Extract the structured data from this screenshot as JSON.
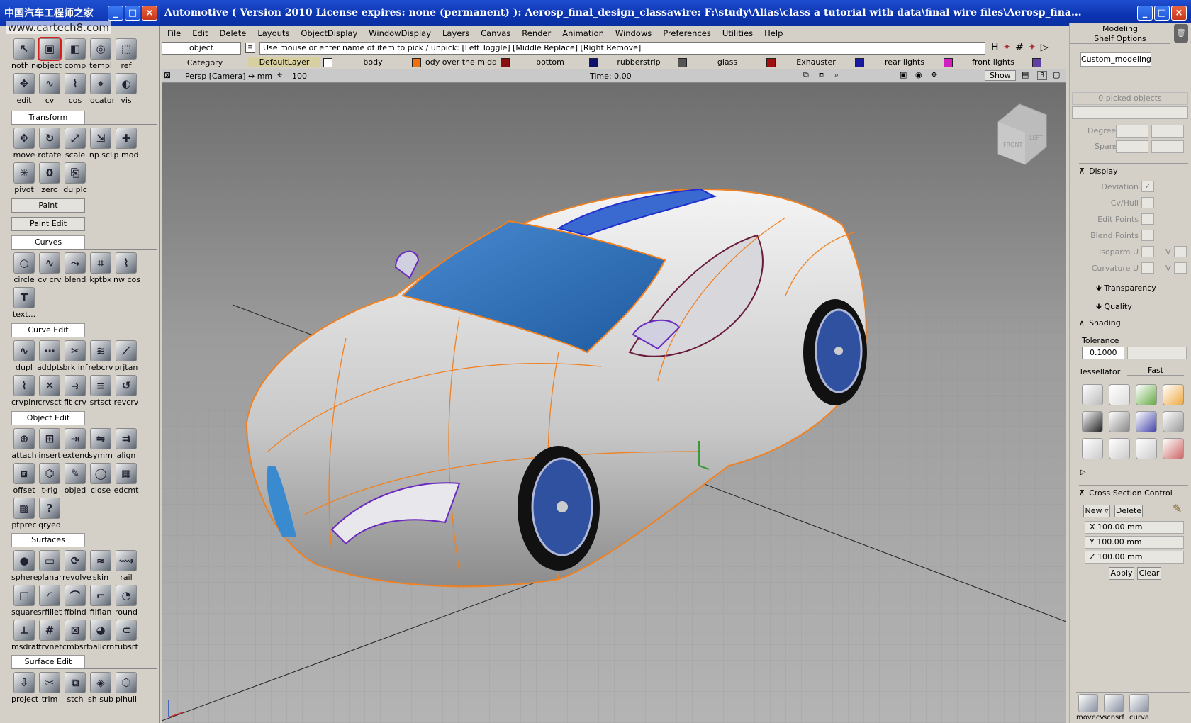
{
  "window": {
    "title": "Automotive ( Version 2010  License expires: none (permanent) ): Aerosp_final_design_classawire: F:\\study\\Alias\\class a tutorial with data\\final wire files\\Aerosp_fina...",
    "palette_title": "中国汽车工程师之家",
    "watermark": "www.cartech8.com"
  },
  "menu": [
    "File",
    "Edit",
    "Delete",
    "Layouts",
    "ObjectDisplay",
    "WindowDisplay",
    "Layers",
    "Canvas",
    "Render",
    "Animation",
    "Windows",
    "Preferences",
    "Utilities",
    "Help"
  ],
  "pick": {
    "mode": "object",
    "message": "Use mouse or enter name of item to pick / unpick: [Left Toggle] [Middle Replace] [Right Remove]"
  },
  "layers": {
    "category_label": "Category",
    "items": [
      {
        "name": "DefaultLayer",
        "color": "#ffffff"
      },
      {
        "name": "body",
        "color": "#f07010"
      },
      {
        "name": "ody over the middle",
        "color": "#8a1010"
      },
      {
        "name": "bottom",
        "color": "#101070"
      },
      {
        "name": "rubberstrip",
        "color": "#555555"
      },
      {
        "name": "glass",
        "color": "#a01010"
      },
      {
        "name": "Exhauster",
        "color": "#1a1aa0"
      },
      {
        "name": "rear lights",
        "color": "#d020c0"
      },
      {
        "name": "front lights",
        "color": "#6040a0"
      }
    ]
  },
  "viewport": {
    "camera": "Persp [Camera] ↔ mm",
    "grid": "100",
    "time": "Time: 0.00",
    "show_button": "Show",
    "layout_num": "3",
    "cube_front": "FRONT",
    "cube_left": "LEFT"
  },
  "palette": {
    "pick_tools": [
      "nothing",
      "object",
      "comp",
      "templ",
      "ref",
      "edit",
      "cv",
      "cos",
      "locator",
      "vis"
    ],
    "transform_label": "Transform",
    "transform_tools": [
      "move",
      "rotate",
      "scale",
      "np scl",
      "p mod",
      "pivot",
      "zero",
      "du plc"
    ],
    "paint_label": "Paint",
    "paint_edit_label": "Paint Edit",
    "curves_label": "Curves",
    "curves_tools": [
      "circle",
      "cv crv",
      "blend",
      "kptbx",
      "nw cos",
      "text..."
    ],
    "curve_edit_label": "Curve Edit",
    "curve_edit_tools": [
      "dupl",
      "addpts",
      "brk inf",
      "rebcrv",
      "prjtan",
      "crvplnr",
      "crvsct",
      "fit crv",
      "srtsct",
      "revcrv"
    ],
    "object_edit_label": "Object Edit",
    "object_edit_tools": [
      "attach",
      "insert",
      "extend",
      "symm",
      "align",
      "offset",
      "t-rig",
      "objed",
      "close",
      "edcmt",
      "ptprec",
      "qryed"
    ],
    "surfaces_label": "Surfaces",
    "surfaces_tools": [
      "sphere",
      "planar",
      "revolve",
      "skin",
      "rail",
      "square",
      "srfillet",
      "ffblnd",
      "filflan",
      "round",
      "msdraft",
      "crvnet",
      "cmbsrf",
      "ballcrn",
      "tubsrf"
    ],
    "surface_edit_label": "Surface Edit",
    "surface_edit_tools": [
      "project",
      "trim",
      "stch",
      "sh sub",
      "plhull"
    ]
  },
  "right_panel": {
    "modeling": "Modeling",
    "shelf_options": "Shelf Options",
    "tab": "Custom_modeling",
    "picked": "0 picked objects",
    "degree": "Degree",
    "spans": "Spans",
    "display": "Display",
    "deviation": "Deviation",
    "cvhull": "Cv/Hull",
    "edit_points": "Edit Points",
    "blend_points": "Blend Points",
    "isoparm": "Isoparm U",
    "curvature": "Curvature U",
    "v": "V",
    "transparency": "Transparency",
    "quality": "Quality",
    "shading": "Shading",
    "tolerance": "Tolerance",
    "tolerance_value": "0.1000",
    "tessellator": "Tessellator",
    "tessellator_value": "Fast",
    "cross_section": "Cross Section Control",
    "new": "New",
    "delete": "Delete",
    "x": "X 100.00 mm",
    "y": "Y 100.00 mm",
    "z": "Z 100.00 mm",
    "apply": "Apply",
    "clear": "Clear",
    "shelf_bottom": [
      "movecv",
      "scnsrf",
      "curva"
    ]
  },
  "colors": {
    "title_blue": "#0a33b0",
    "wire": "#f08020",
    "glass": "#3a78c0"
  }
}
